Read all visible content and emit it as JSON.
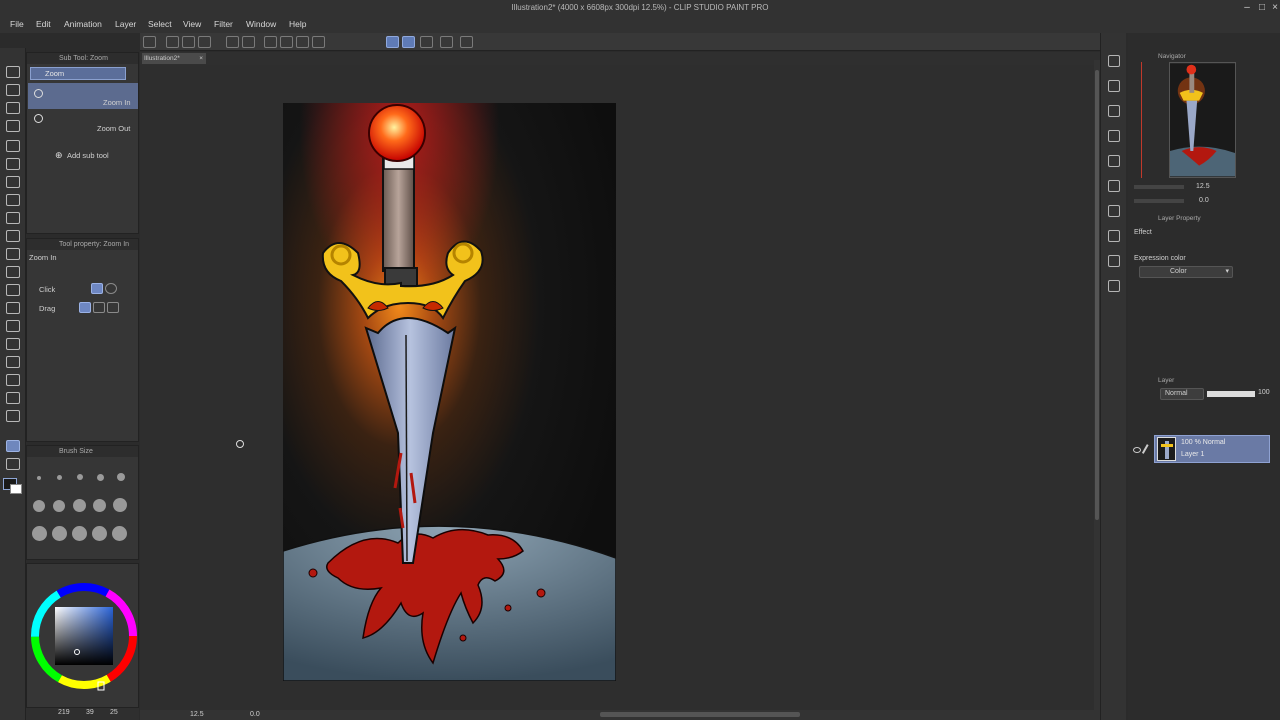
{
  "window": {
    "title": "Illustration2* (4000 x 6608px 300dpi 12.5%) - CLIP STUDIO PAINT PRO"
  },
  "menu": {
    "items": [
      "File",
      "Edit",
      "Animation",
      "Layer",
      "Select",
      "View",
      "Filter",
      "Window",
      "Help"
    ]
  },
  "document_tab": "Illustration2*",
  "subtool_panel": {
    "header": "Sub Tool: Zoom",
    "group": "Zoom",
    "items": [
      "Zoom In",
      "Zoom Out"
    ],
    "add_label": "Add sub tool"
  },
  "tool_property_panel": {
    "header": "Tool property: Zoom In",
    "tool_name": "Zoom In",
    "rows": [
      "Click",
      "Drag"
    ]
  },
  "brush_size_panel": {
    "header": "Brush Size"
  },
  "status_bar": {
    "zoom": "12.5",
    "angle": "0.0",
    "bottom_left_1": "219",
    "bottom_left_2": "39",
    "bottom_left_3": "25"
  },
  "navigator": {
    "header": "Navigator",
    "zoom": "12.5",
    "rotation": "0.0"
  },
  "layer_property": {
    "header": "Layer Property",
    "effect_label": "Effect",
    "expression_label": "Expression color",
    "expression_value": "Color"
  },
  "layer_panel": {
    "header": "Layer",
    "blend_mode": "Normal",
    "opacity": "100",
    "layer_mode": "100 % Normal",
    "layer_name": "Layer 1"
  },
  "colors": {
    "accent": "#6e87c2",
    "background": "#2e2e2e",
    "panel": "#363636"
  }
}
